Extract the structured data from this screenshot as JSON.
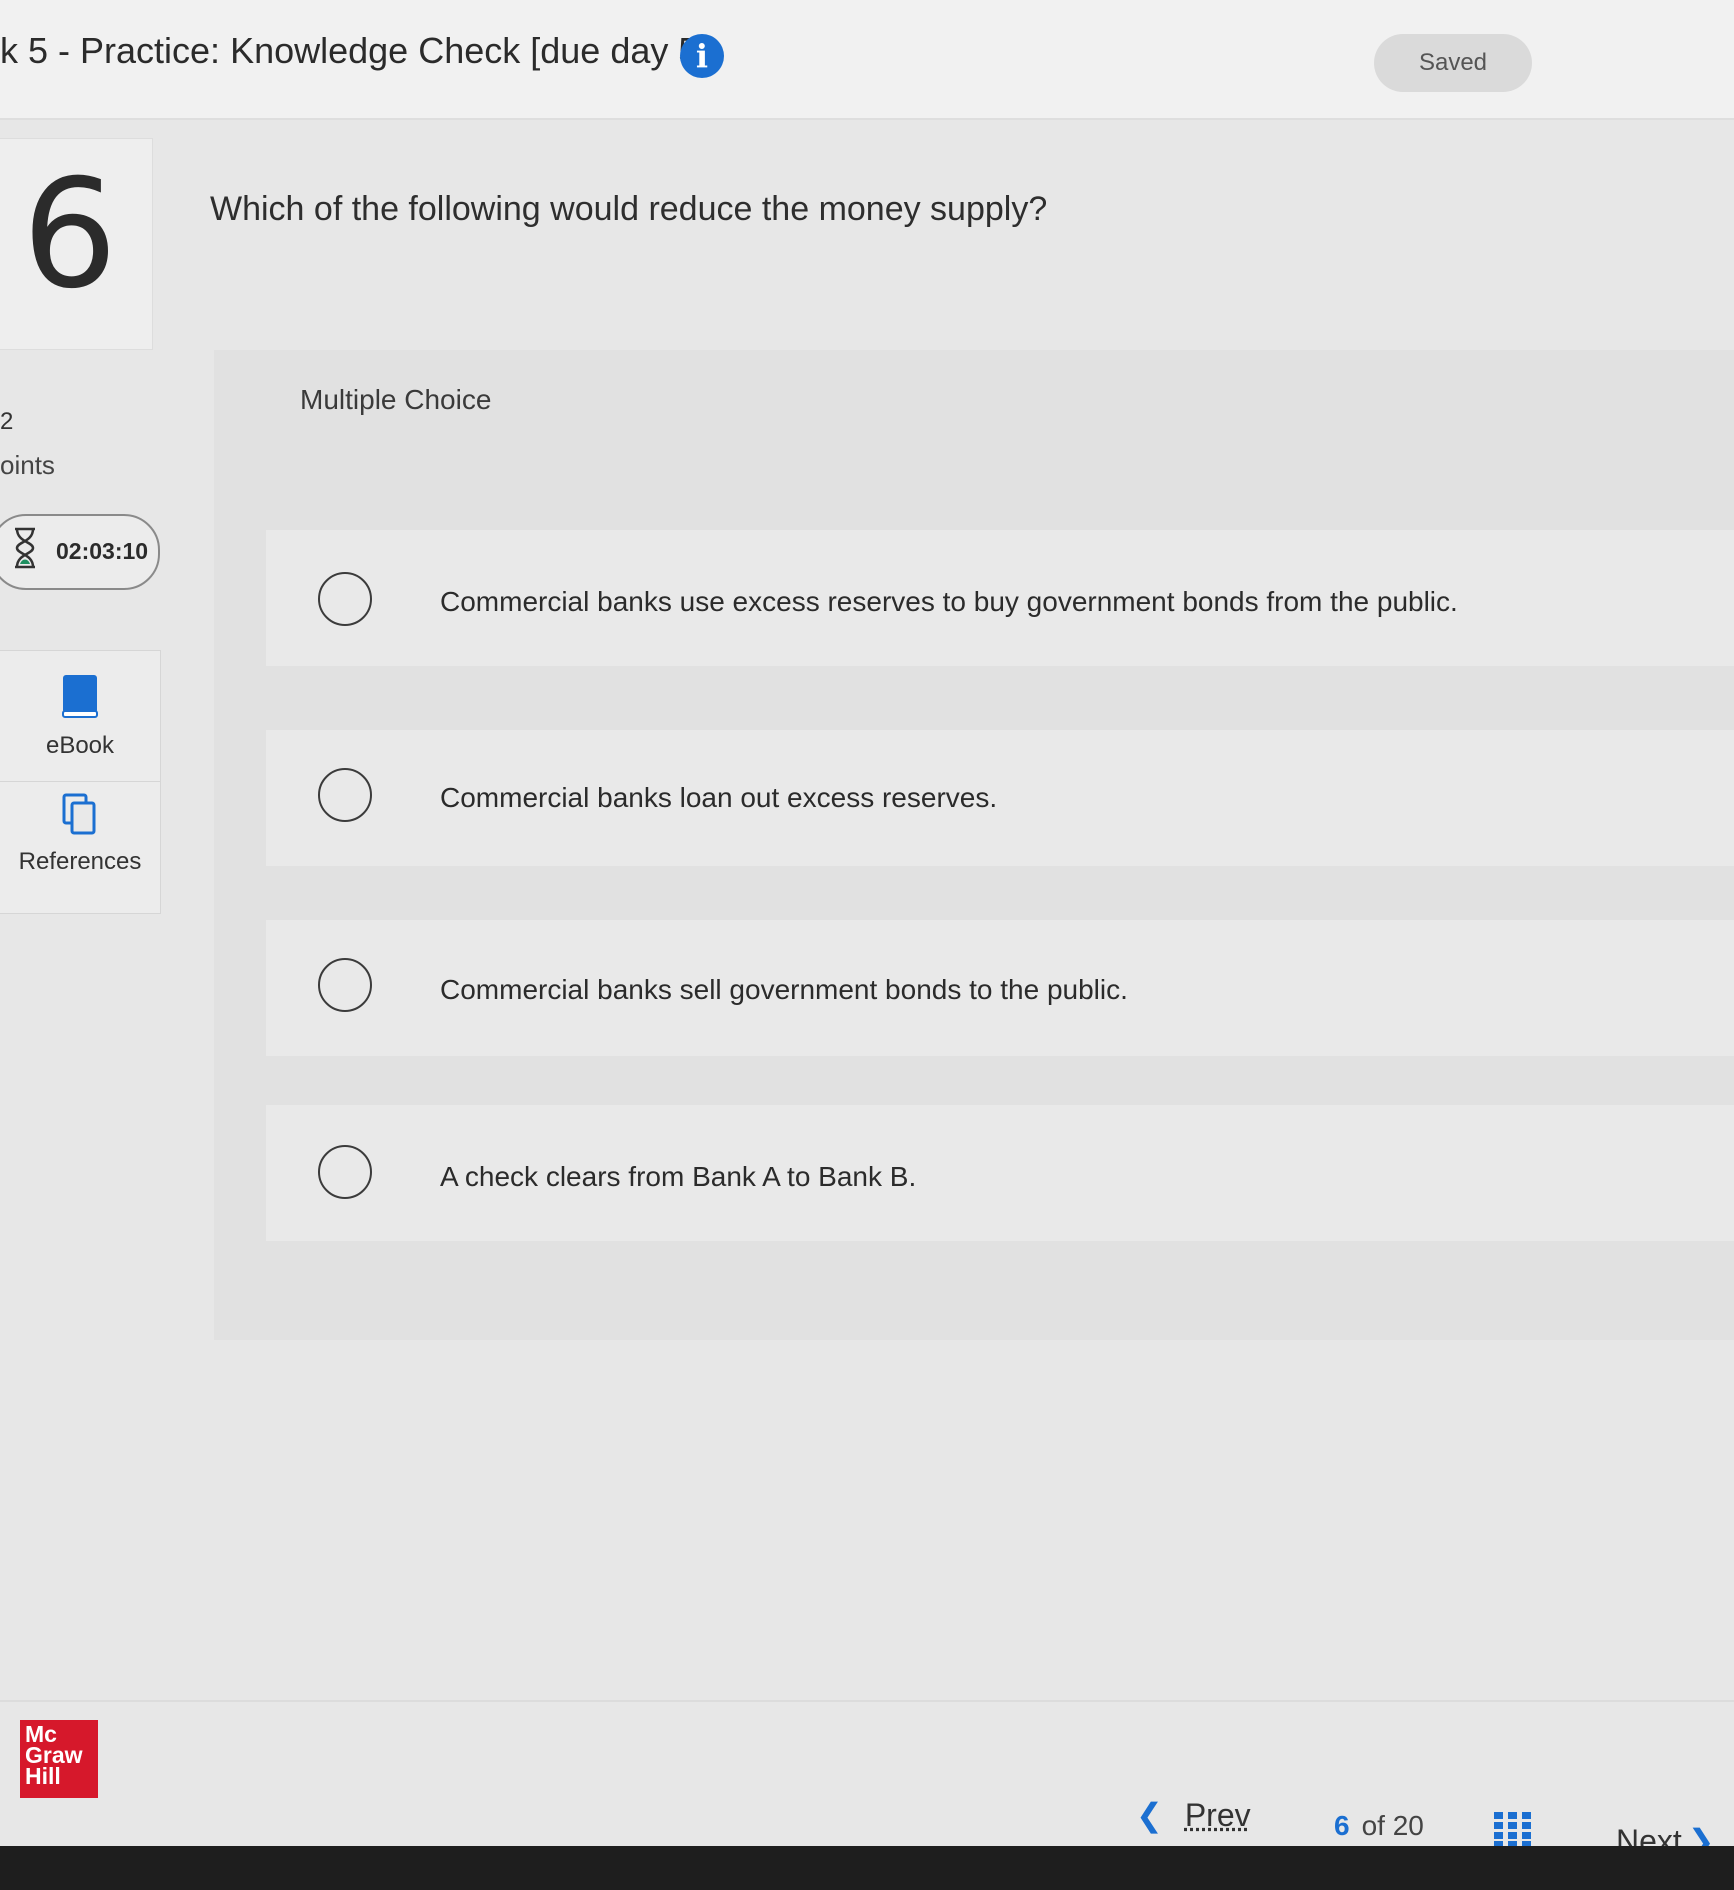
{
  "header": {
    "title": "k 5 - Practice: Knowledge Check [due day 5]",
    "info_icon": "info-icon",
    "status": "Saved"
  },
  "question": {
    "number": "6",
    "points_value": "2",
    "points_label": "oints",
    "text": "Which of the following would reduce the money supply?",
    "type_label": "Multiple Choice",
    "options": [
      "Commercial banks use excess reserves to buy government bonds from the public.",
      "Commercial banks loan out excess reserves.",
      "Commercial banks sell government bonds to the public.",
      "A check clears from Bank A to Bank B."
    ]
  },
  "timer": {
    "value": "02:03:10",
    "icon": "hourglass-icon"
  },
  "tools": [
    {
      "label": "eBook",
      "icon": "book-icon"
    },
    {
      "label": "References",
      "icon": "copy-icon"
    }
  ],
  "footer": {
    "logo_lines": [
      "Mc",
      "Graw",
      "Hill"
    ],
    "prev_label": "Prev",
    "current_page": "6",
    "of_label": "of 20",
    "next_label": "Next",
    "accent": "#1b6fd1"
  }
}
